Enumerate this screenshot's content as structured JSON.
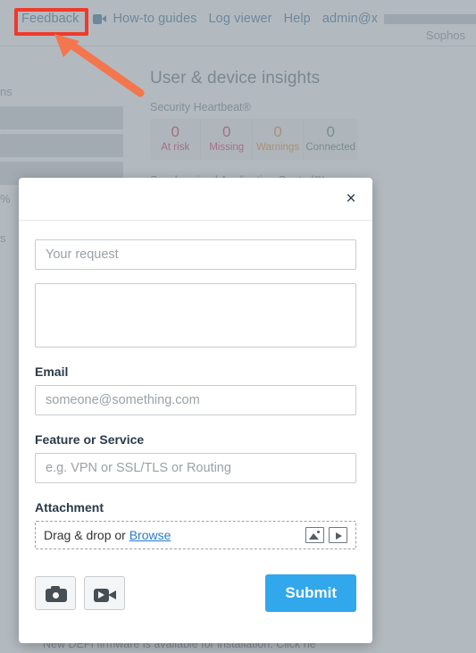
{
  "header": {
    "nav": [
      {
        "label": "Feedback",
        "icon": null,
        "highlighted": true
      },
      {
        "label": "How-to guides",
        "icon": "video-camera-icon"
      },
      {
        "label": "Log viewer",
        "icon": null
      },
      {
        "label": "Help",
        "icon": null
      },
      {
        "label": "admin@x",
        "icon": "chevron-down-icon",
        "redacted": true
      }
    ],
    "brand": "Sophos"
  },
  "background": {
    "left_fragments": [
      "ns",
      "%",
      "s"
    ],
    "insights": {
      "title": "User & device insights",
      "heartbeat_label": "Security Heartbeat®",
      "stats": [
        {
          "value": "0",
          "label": "At risk",
          "color": "#d0213f"
        },
        {
          "value": "0",
          "label": "Missing",
          "color": "#d4215e"
        },
        {
          "value": "0",
          "label": "Warnings",
          "color": "#e08524"
        },
        {
          "value": "0",
          "label": "Connected",
          "color": "#4a7d63"
        }
      ],
      "sync_app_control_label": "Synchronized Application Control™"
    },
    "bottom_note": "New DEFI firmware is available for installation. Click he"
  },
  "modal": {
    "close_icon": "×",
    "request": {
      "placeholder": "Your request",
      "value": ""
    },
    "description": {
      "placeholder": "",
      "value": ""
    },
    "email": {
      "label": "Email",
      "placeholder": "someone@something.com",
      "value": ""
    },
    "feature": {
      "label": "Feature or Service",
      "placeholder": "e.g. VPN or SSL/TLS or Routing",
      "value": ""
    },
    "attachment": {
      "label": "Attachment",
      "drop_text": "Drag & drop or",
      "browse_label": "Browse",
      "icons": [
        "image-icon",
        "video-icon"
      ]
    },
    "footer": {
      "camera_icon": "camera-icon",
      "video_icon": "video-camera-icon",
      "submit_label": "Submit",
      "submit_color": "#31a7ec"
    }
  },
  "annotation": {
    "box_color": "#f0392b",
    "arrow_color": "#f4764e",
    "target": "Feedback"
  }
}
